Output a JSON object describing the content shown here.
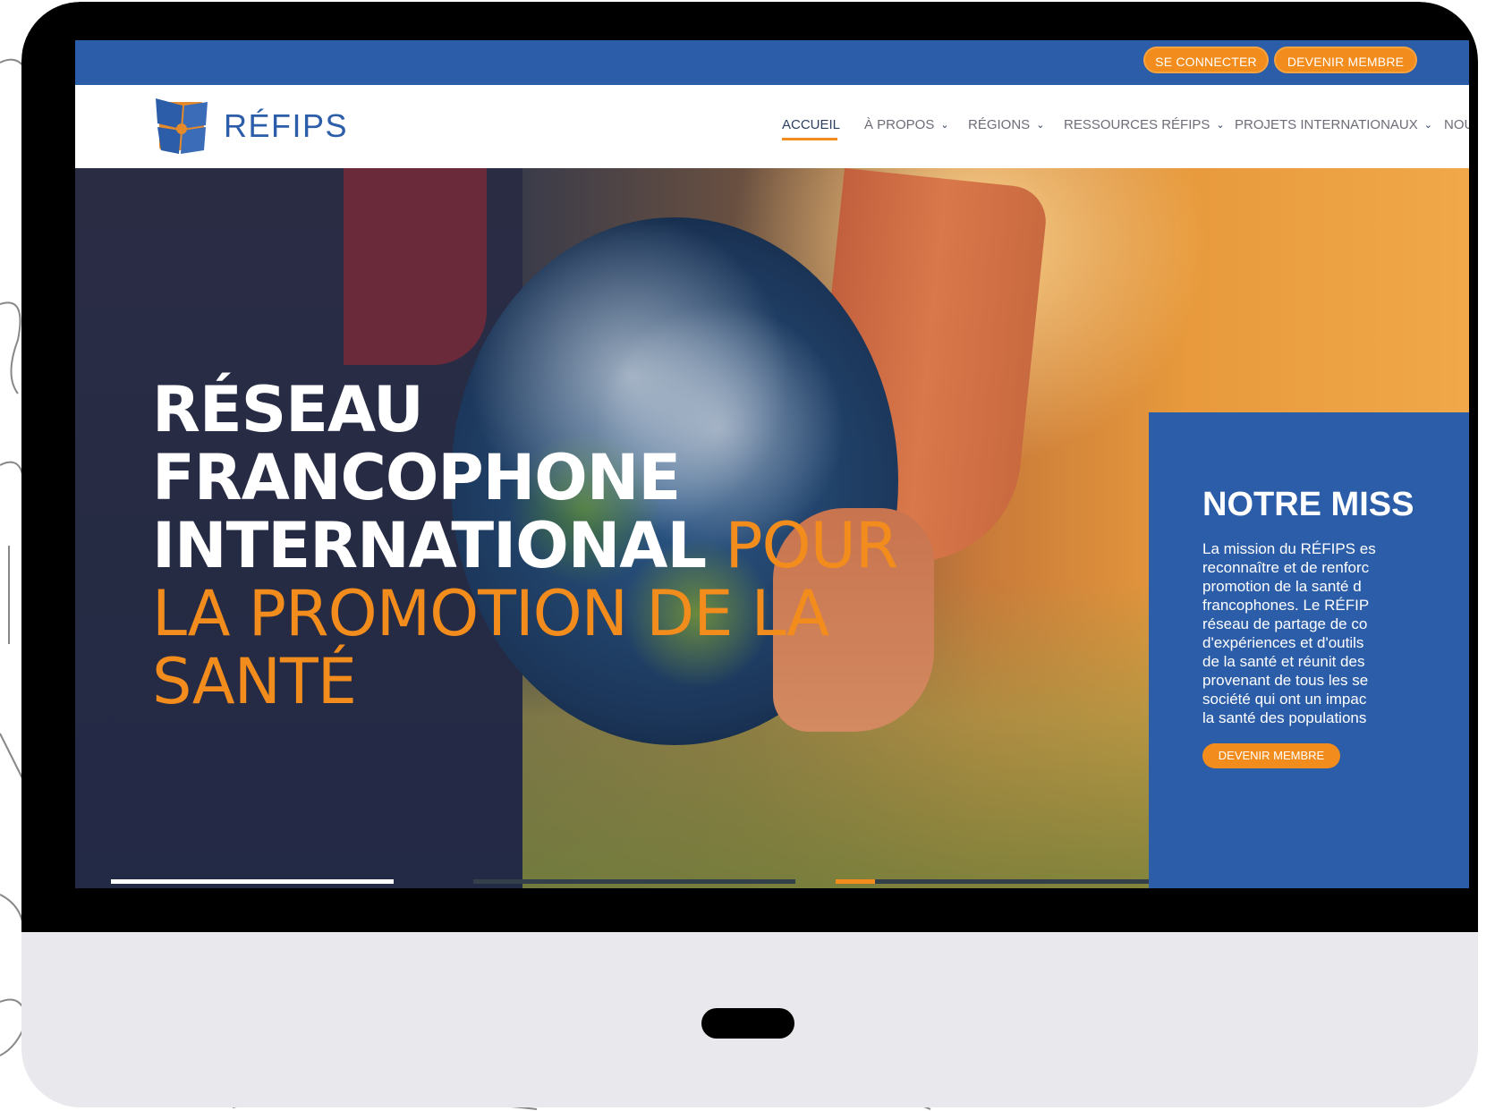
{
  "colors": {
    "primary_blue": "#2c5da8",
    "accent_orange": "#f28c1c",
    "bezel": "#000000",
    "monitor_chin": "#e9e8ec"
  },
  "topbar": {
    "login_label": "SE CONNECTER",
    "join_label": "DEVENIR MEMBRE"
  },
  "brand": {
    "name": "RÉFIPS",
    "logo_icon": "refips-logo-icon"
  },
  "nav": {
    "items": [
      {
        "label": "ACCUEIL",
        "active": true,
        "dropdown": false
      },
      {
        "label": "À PROPOS",
        "active": false,
        "dropdown": true
      },
      {
        "label": "RÉGIONS",
        "active": false,
        "dropdown": true
      },
      {
        "label": "RESSOURCES RÉFIPS",
        "active": false,
        "dropdown": true
      },
      {
        "label": "PROJETS INTERNATIONAUX",
        "active": false,
        "dropdown": true
      },
      {
        "label": "NOU",
        "active": false,
        "dropdown": false
      }
    ]
  },
  "hero": {
    "title_line1": "RÉSEAU FRANCOPHONE",
    "title_line2_white": "INTERNATIONAL",
    "title_line2_orange": " POUR",
    "title_line3": "LA PROMOTION DE LA",
    "title_line4": "SANTÉ"
  },
  "mission": {
    "title": "NOTRE MISS",
    "text": "La mission du RÉFIPS es\nreconnaître et de renforc\npromotion de la santé d\nfrancophones. Le RÉFIP\nréseau de partage de co\nd'expériences et d'outils\nde la santé et réunit des\nprovenant de tous les se\nsociété qui ont un impac\nla santé des populations",
    "button_label": "DEVENIR MEMBRE"
  }
}
